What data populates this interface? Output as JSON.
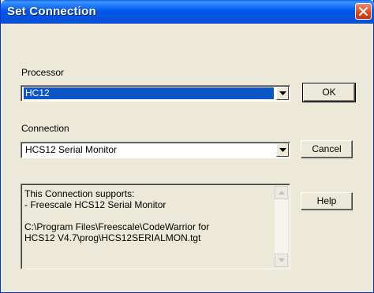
{
  "window": {
    "title": "Set Connection"
  },
  "processor": {
    "label": "Processor",
    "selected": "HC12"
  },
  "connection": {
    "label": "Connection",
    "selected": "HCS12 Serial Monitor"
  },
  "buttons": {
    "ok": "OK",
    "cancel": "Cancel",
    "help": "Help"
  },
  "info": {
    "text": "This Connection supports:\n- Freescale HCS12 Serial Monitor\n\nC:\\Program Files\\Freescale\\CodeWarrior for\nHCS12 V4.7\\prog\\HCS12SERIALMON.tgt"
  },
  "icons": {
    "close": "close-x-icon",
    "dropdown": "chevron-down-icon",
    "scroll_up": "scroll-up-arrow-icon",
    "scroll_down": "scroll-down-arrow-icon"
  },
  "colors": {
    "titlebar": "#0055e5",
    "close_button": "#de4a22",
    "dialog_bg": "#ece9d8",
    "selection": "#0b55c4"
  }
}
